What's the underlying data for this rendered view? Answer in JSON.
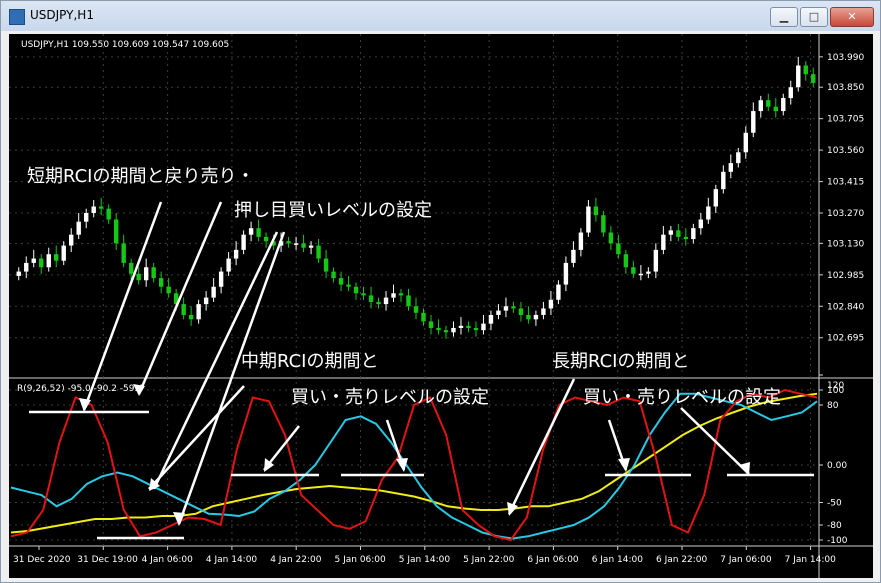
{
  "window": {
    "title": "USDJPY,H1",
    "minimize_glyph": "▁",
    "maximize_glyph": "□",
    "close_glyph": "✕"
  },
  "header": {
    "symbol_info": "USDJPY,H1  109.550 109.609 109.547 109.605"
  },
  "price_axis": [
    "103.990",
    "103.850",
    "103.705",
    "103.560",
    "103.415",
    "103.270",
    "103.130",
    "102.985",
    "102.840",
    "102.695"
  ],
  "indicator": {
    "label": "R(9,26,52) -95.0 -90.2 -59.4",
    "axis": [
      "120",
      "100",
      "80",
      "0.00",
      "-50",
      "-80",
      "-100"
    ]
  },
  "time_axis": [
    "31 Dec 2020",
    "31 Dec 19:00",
    "4 Jan 06:00",
    "4 Jan 14:00",
    "4 Jan 22:00",
    "5 Jan 06:00",
    "5 Jan 14:00",
    "5 Jan 22:00",
    "6 Jan 06:00",
    "6 Jan 14:00",
    "6 Jan 22:00",
    "7 Jan 06:00",
    "7 Jan 14:00"
  ],
  "annotations": {
    "short_1": "短期RCIの期間と戻り売り・",
    "short_2": "押し目買いレベルの設定",
    "mid_1": "中期RCIの期間と",
    "mid_2": "買い・売りレベルの設定",
    "long_1": "長期RCIの期間と",
    "long_2": "買い・売りレベルの設定"
  },
  "colors": {
    "bull": "#ffffff",
    "bear": "#16c816",
    "rci_short": "#e11414",
    "rci_mid": "#27c9e4",
    "rci_long": "#f0ec14",
    "annotation": "#ffffff"
  },
  "chart_data": [
    {
      "type": "candlestick",
      "title": "USDJPY,H1",
      "ylim": [
        102.62,
        104.04
      ],
      "close": [
        103.0,
        103.04,
        103.06,
        103.02,
        103.08,
        103.05,
        103.12,
        103.17,
        103.23,
        103.27,
        103.3,
        103.29,
        103.24,
        103.13,
        103.04,
        102.99,
        102.96,
        103.02,
        102.97,
        102.93,
        102.9,
        102.85,
        102.8,
        102.78,
        102.85,
        102.88,
        102.93,
        103.0,
        103.06,
        103.1,
        103.17,
        103.2,
        103.16,
        103.14,
        103.12,
        103.14,
        103.13,
        103.13,
        103.11,
        103.12,
        103.06,
        103.0,
        102.97,
        102.94,
        102.93,
        102.9,
        102.89,
        102.86,
        102.85,
        102.88,
        102.9,
        102.89,
        102.84,
        102.81,
        102.77,
        102.74,
        102.73,
        102.72,
        102.74,
        102.75,
        102.74,
        102.73,
        102.76,
        102.8,
        102.82,
        102.84,
        102.83,
        102.8,
        102.78,
        102.8,
        102.83,
        102.87,
        102.94,
        103.04,
        103.1,
        103.18,
        103.3,
        103.26,
        103.18,
        103.13,
        103.08,
        103.02,
        102.99,
        102.99,
        103.0,
        103.1,
        103.17,
        103.19,
        103.16,
        103.15,
        103.2,
        103.24,
        103.3,
        103.38,
        103.46,
        103.5,
        103.55,
        103.64,
        103.74,
        103.79,
        103.76,
        103.74,
        103.8,
        103.85,
        103.95,
        103.91,
        103.87
      ]
    },
    {
      "type": "line",
      "title": "R(9,26,52)",
      "ylim": [
        -100,
        100
      ],
      "x": [
        "31 Dec 2020",
        "31 Dec 19:00",
        "4 Jan 06:00",
        "4 Jan 14:00",
        "4 Jan 22:00",
        "5 Jan 06:00",
        "5 Jan 14:00",
        "5 Jan 22:00",
        "6 Jan 06:00",
        "6 Jan 14:00",
        "6 Jan 22:00",
        "7 Jan 06:00",
        "7 Jan 14:00"
      ],
      "series": [
        {
          "name": "RCI 9",
          "values": [
            -95,
            -90,
            -60,
            30,
            90,
            80,
            30,
            -60,
            -95,
            -90,
            -80,
            -70,
            -72,
            -80,
            20,
            90,
            85,
            40,
            -40,
            -60,
            -80,
            -85,
            -75,
            -20,
            10,
            80,
            90,
            40,
            -60,
            -80,
            -95,
            -100,
            -70,
            20,
            80,
            90,
            85,
            80,
            90,
            85,
            10,
            -80,
            -90,
            -40,
            60,
            85,
            95,
            90,
            100,
            95,
            90
          ]
        },
        {
          "name": "RCI 26",
          "values": [
            -30,
            -35,
            -40,
            -55,
            -45,
            -25,
            -15,
            -10,
            -15,
            -25,
            -35,
            -45,
            -55,
            -65,
            -66,
            -68,
            -62,
            -45,
            -35,
            -20,
            0,
            30,
            60,
            65,
            55,
            30,
            0,
            -30,
            -55,
            -70,
            -80,
            -90,
            -95,
            -98,
            -95,
            -90,
            -85,
            -80,
            -70,
            -55,
            -30,
            0,
            40,
            70,
            95,
            95,
            90,
            85,
            80,
            70,
            60,
            65,
            70,
            85
          ]
        },
        {
          "name": "RCI 52",
          "values": [
            -90,
            -88,
            -84,
            -80,
            -76,
            -72,
            -72,
            -70,
            -70,
            -68,
            -68,
            -65,
            -55,
            -50,
            -45,
            -40,
            -36,
            -32,
            -30,
            -28,
            -30,
            -32,
            -34,
            -38,
            -42,
            -48,
            -55,
            -58,
            -60,
            -60,
            -58,
            -55,
            -55,
            -50,
            -45,
            -35,
            -20,
            -5,
            10,
            25,
            40,
            52,
            62,
            70,
            78,
            84,
            88,
            92,
            95
          ]
        }
      ]
    }
  ]
}
